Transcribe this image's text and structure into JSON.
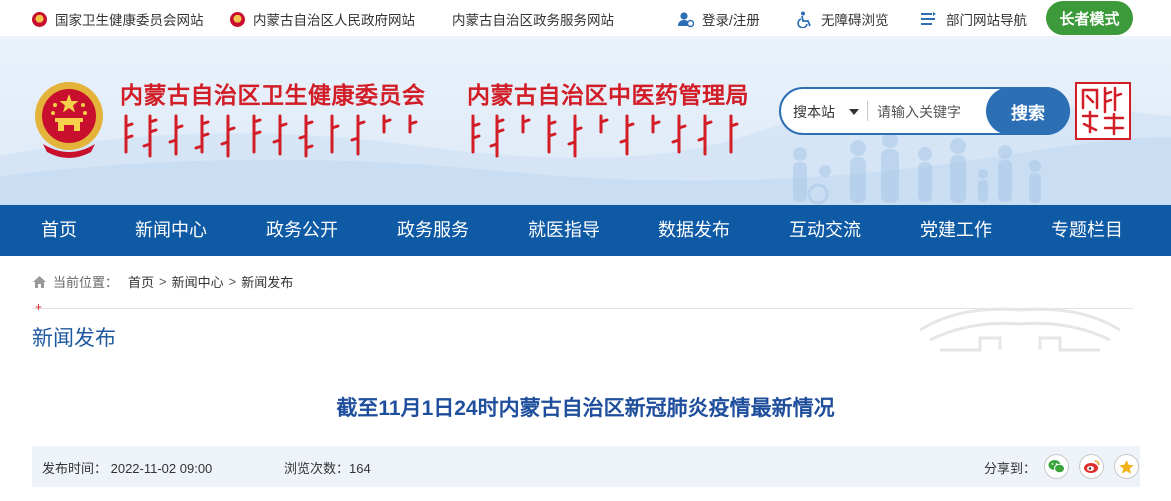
{
  "topbar": {
    "links": [
      {
        "label": "国家卫生健康委员会网站"
      },
      {
        "label": "内蒙古自治区人民政府网站"
      },
      {
        "label": "内蒙古自治区政务服务网站"
      }
    ],
    "login": "登录/注册",
    "accessibility": "无障碍浏览",
    "dept_nav": "部门网站导航",
    "elder_mode": "长者模式"
  },
  "header": {
    "org1": "内蒙古自治区卫生健康委员会",
    "org2": "内蒙古自治区中医药管理局",
    "brand_color": "#d21d26"
  },
  "search": {
    "scope": "搜本站",
    "placeholder": "请输入关键字",
    "button": "搜索"
  },
  "nav": {
    "items": [
      {
        "label": "首页"
      },
      {
        "label": "新闻中心"
      },
      {
        "label": "政务公开"
      },
      {
        "label": "政务服务"
      },
      {
        "label": "就医指导"
      },
      {
        "label": "数据发布"
      },
      {
        "label": "互动交流"
      },
      {
        "label": "党建工作"
      },
      {
        "label": "专题栏目"
      }
    ],
    "bg_color": "#0f5aa5"
  },
  "breadcrumb": {
    "label": "当前位置：",
    "items": [
      "首页",
      "新闻中心",
      "新闻发布"
    ],
    "separator": ">"
  },
  "section": {
    "title": "新闻发布"
  },
  "article": {
    "title": "截至11月1日24时内蒙古自治区新冠肺炎疫情最新情况",
    "publish_time": "发布时间：  2022-11-02 09:00",
    "views": "浏览次数：164",
    "share_label": "分享到："
  },
  "icons": {
    "share": [
      "wechat-icon",
      "weibo-icon",
      "favorite-star-icon"
    ]
  }
}
